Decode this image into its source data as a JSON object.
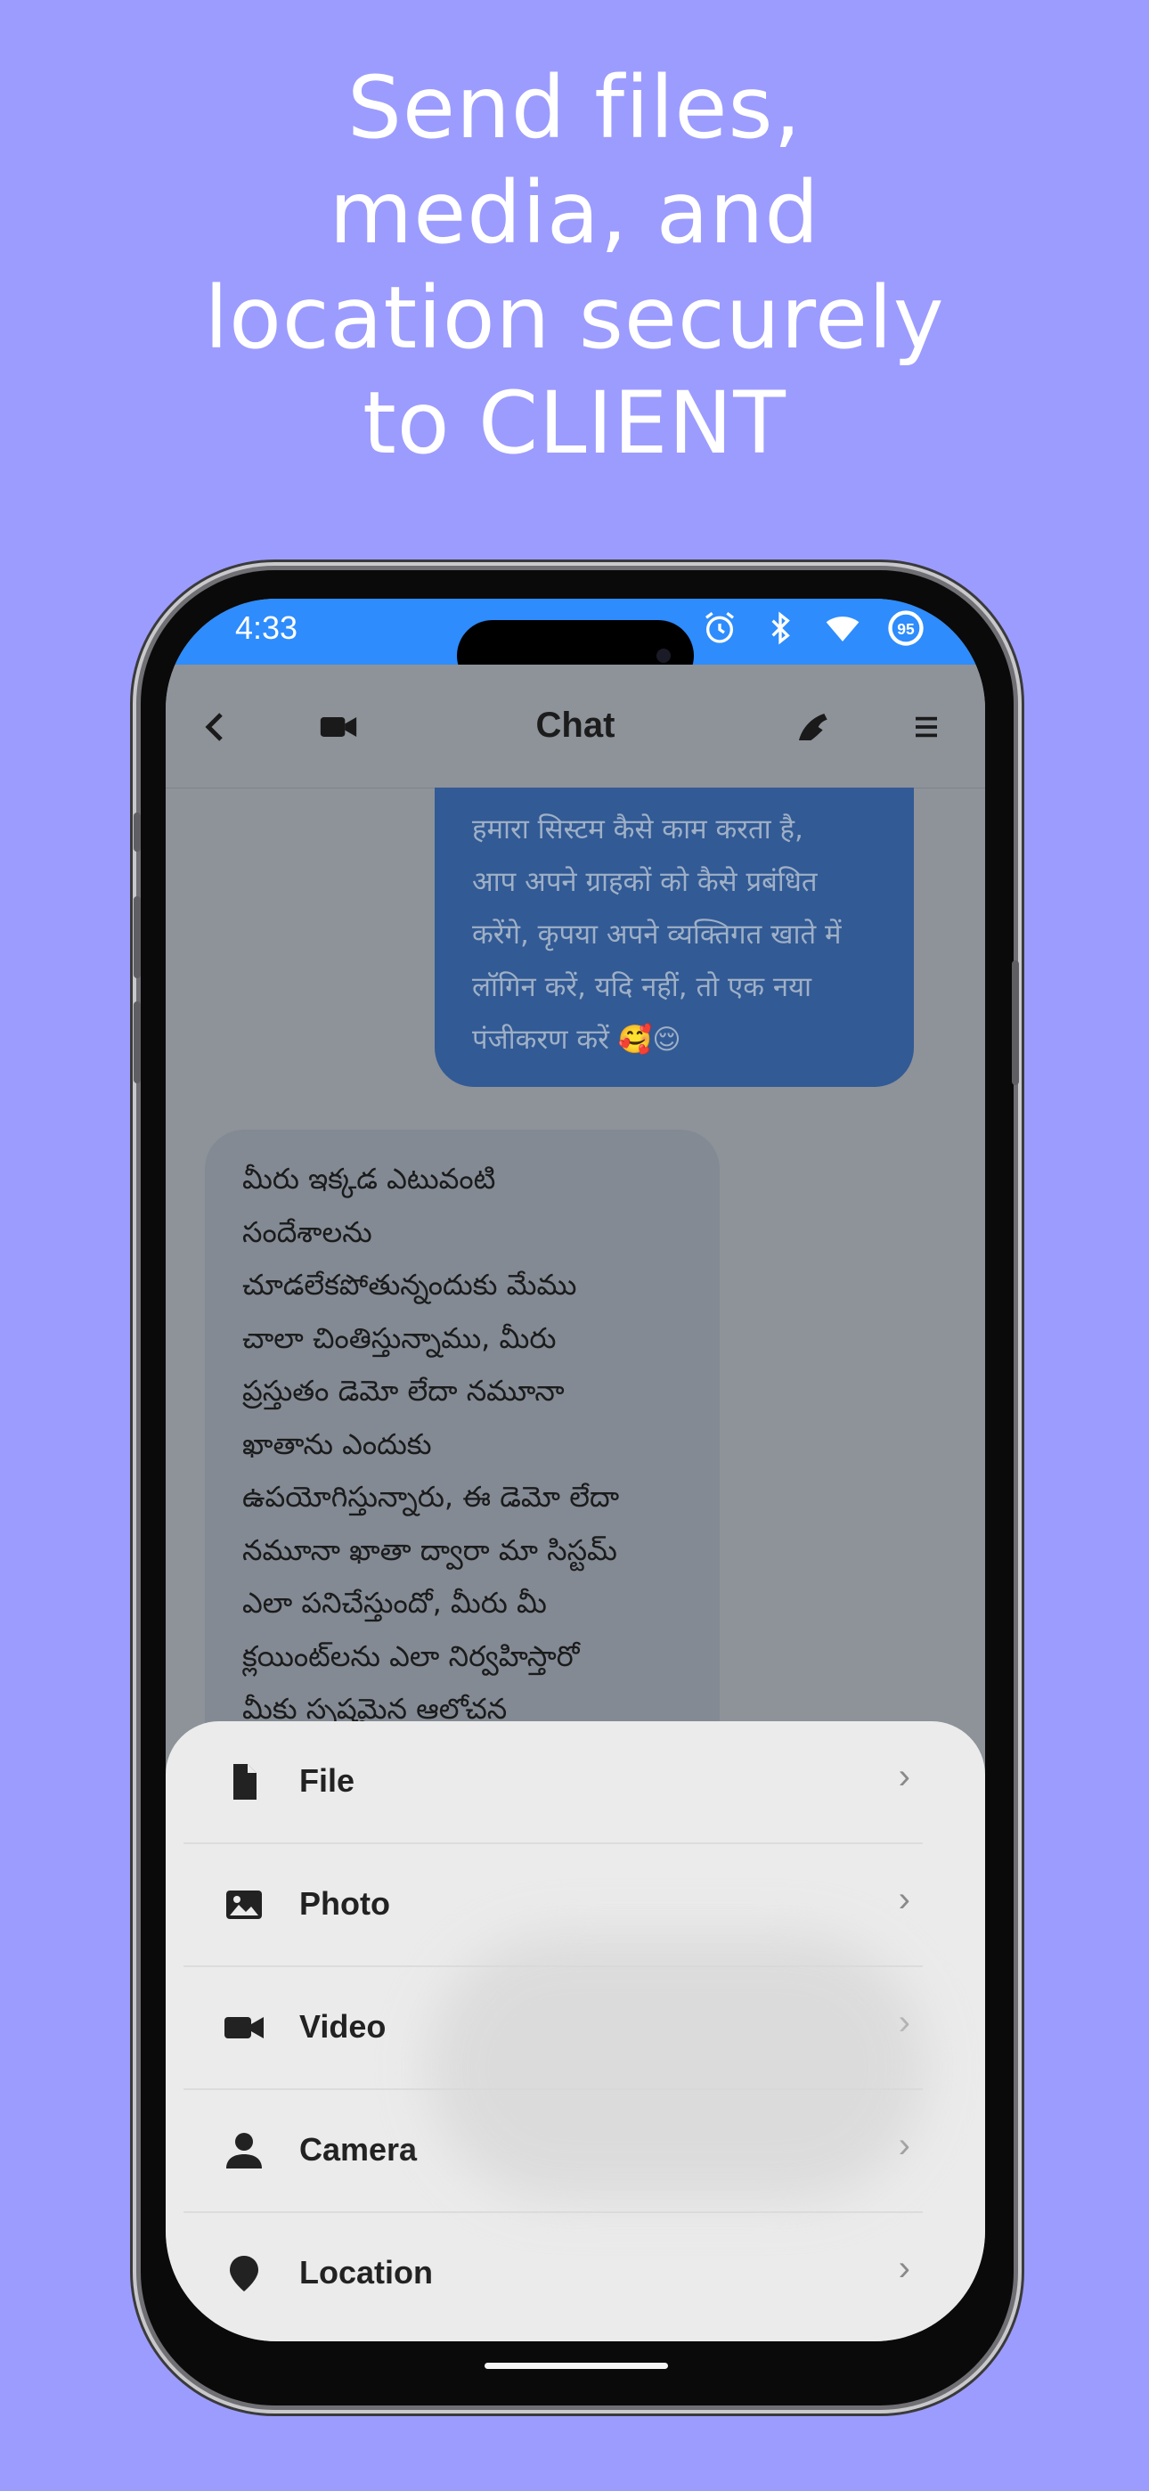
{
  "headline": [
    "Send files,",
    "media, and",
    "location securely",
    "to CLIENT"
  ],
  "status_bar": {
    "time": "4:33",
    "icons": [
      "alarm-icon",
      "bluetooth-icon",
      "wifi-icon",
      "battery-icon"
    ],
    "battery_level": "95"
  },
  "app_bar": {
    "title": "Chat",
    "back_icon": "chevron-left-icon",
    "video_icon": "video-camera-icon",
    "call_icon": "phone-icon",
    "menu_icon": "hamburger-menu-icon"
  },
  "messages": {
    "outgoing": {
      "lines": [
        "हमारा सिस्टम कैसे काम करता है,",
        "आप अपने ग्राहकों को कैसे प्रबंधित",
        "करेंगे, कृपया अपने व्यक्तिगत खाते में",
        "लॉगिन करें, यदि नहीं, तो एक नया",
        "पंजीकरण करें 🥰😌"
      ]
    },
    "incoming": {
      "lines": [
        "మీరు ఇక్కడ ఎటువంటి",
        "సందేశాలను",
        "చూడలేకపోతున్నందుకు మేము",
        "చాలా చింతిస్తున్నాము, మీరు",
        "ప్రస్తుతం డెమో లేదా నమూనా",
        "ఖాతాను ఎందుకు",
        "ఉపయోగిస్తున్నారు, ఈ డెమో లేదా",
        "నమూనా ఖాతా ద్వారా మా సిస్టమ్",
        "ఎలా పనిచేస్తుందో, మీరు మీ",
        "క్లయింట్‌లను ఎలా నిర్వహిస్తారో",
        "మీకు స్పష్టమైన ఆలోచన"
      ]
    }
  },
  "sheet": {
    "items": [
      {
        "label": "File",
        "icon": "file-icon"
      },
      {
        "label": "Photo",
        "icon": "photo-icon"
      },
      {
        "label": "Video",
        "icon": "video-icon"
      },
      {
        "label": "Camera",
        "icon": "person-icon"
      },
      {
        "label": "Location",
        "icon": "location-pin-icon"
      }
    ],
    "chevron": "›"
  },
  "colors": {
    "background": "#9c9cfe",
    "status_bar": "#2e8cfc",
    "outgoing_bubble": "#325a95",
    "incoming_bubble": "#838a94",
    "sheet": "#ebebeb"
  }
}
